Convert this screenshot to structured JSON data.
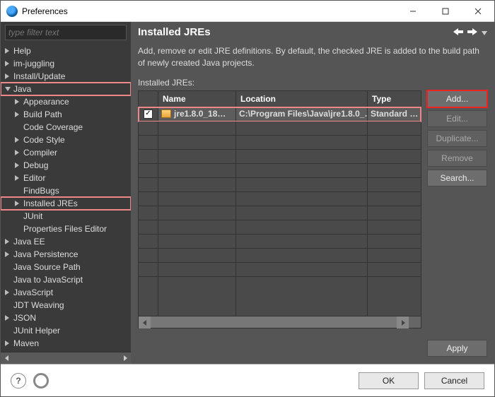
{
  "window": {
    "title": "Preferences"
  },
  "filter": {
    "placeholder": "type filter text"
  },
  "tree": {
    "help": "Help",
    "imjuggling": "im-juggling",
    "install": "Install/Update",
    "java": "Java",
    "appearance": "Appearance",
    "buildpath": "Build Path",
    "codecov": "Code Coverage",
    "codestyle": "Code Style",
    "compiler": "Compiler",
    "debug": "Debug",
    "editor": "Editor",
    "findbugs": "FindBugs",
    "installedjres": "Installed JREs",
    "junit": "JUnit",
    "propfiles": "Properties Files Editor",
    "javaee": "Java EE",
    "javapersist": "Java Persistence",
    "javasrc": "Java Source Path",
    "java2js": "Java to JavaScript",
    "javascript": "JavaScript",
    "jdt": "JDT Weaving",
    "json": "JSON",
    "junithelper": "JUnit Helper",
    "maven": "Maven"
  },
  "page": {
    "title": "Installed JREs",
    "desc": "Add, remove or edit JRE definitions. By default, the checked JRE is added to the build path of newly created Java projects.",
    "label": "Installed JREs:"
  },
  "table": {
    "headers": {
      "name": "Name",
      "location": "Location",
      "type": "Type"
    },
    "row": {
      "checked": true,
      "name": "jre1.8.0_18…",
      "location": "C:\\Program Files\\Java\\jre1.8.0_…",
      "type": "Standard …"
    }
  },
  "buttons": {
    "add": "Add...",
    "edit": "Edit...",
    "duplicate": "Duplicate...",
    "remove": "Remove",
    "search": "Search...",
    "apply": "Apply",
    "ok": "OK",
    "cancel": "Cancel"
  }
}
